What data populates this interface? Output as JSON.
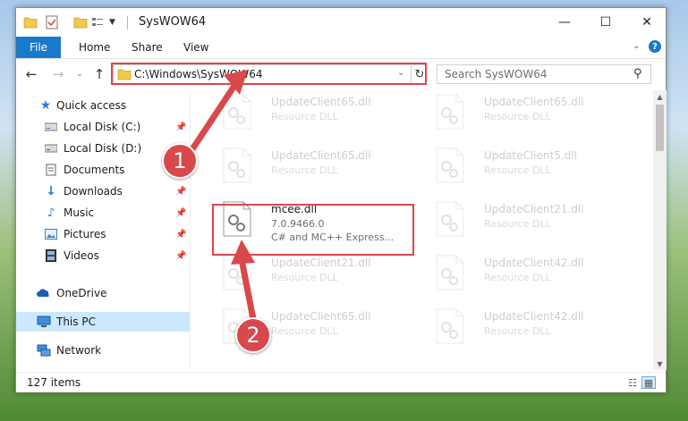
{
  "window": {
    "title": "SysWOW64",
    "controls": {
      "minimize": "—",
      "maximize": "☐",
      "close": "✕"
    }
  },
  "ribbon": {
    "tabs": [
      "File",
      "Home",
      "Share",
      "View"
    ],
    "help": "?"
  },
  "address_bar": {
    "path": "C:\\Windows\\SysWOW64",
    "refresh_icon": "↻"
  },
  "search": {
    "placeholder": "Search SysWOW64"
  },
  "sidebar": {
    "items": [
      {
        "label": "Quick access",
        "icon": "star-icon",
        "pinned": false
      },
      {
        "label": "Local Disk (C:)",
        "icon": "drive-icon",
        "pinned": true
      },
      {
        "label": "Local Disk (D:)",
        "icon": "drive-icon",
        "pinned": false
      },
      {
        "label": "Documents",
        "icon": "documents-icon",
        "pinned": true
      },
      {
        "label": "Downloads",
        "icon": "download-icon",
        "pinned": true
      },
      {
        "label": "Music",
        "icon": "music-icon",
        "pinned": true
      },
      {
        "label": "Pictures",
        "icon": "pictures-icon",
        "pinned": true
      },
      {
        "label": "Videos",
        "icon": "videos-icon",
        "pinned": true
      },
      {
        "label": "OneDrive",
        "icon": "cloud-icon",
        "pinned": false
      },
      {
        "label": "This PC",
        "icon": "computer-icon",
        "pinned": false,
        "selected": true
      },
      {
        "label": "Network",
        "icon": "network-icon",
        "pinned": false
      }
    ]
  },
  "files": {
    "left": [
      {
        "name": "UpdateClient65.dll",
        "desc": "Resource DLL"
      },
      {
        "name": "UpdateClient65.dll",
        "desc": "Resource DLL"
      },
      {
        "name": "mcee.dll",
        "desc": "7.0.9466.0",
        "desc2": "C# and MC++ Express...",
        "focus": true
      },
      {
        "name": "UpdateClient21.dll",
        "desc": "Resource DLL"
      },
      {
        "name": "UpdateClient65.dll",
        "desc": "Resource DLL"
      }
    ],
    "right": [
      {
        "name": "UpdateClient65.dll",
        "desc": "Resource DLL"
      },
      {
        "name": "UpdateClient5.dll",
        "desc": "Resource DLL"
      },
      {
        "name": "UpdateClient21.dll",
        "desc": "Resource DLL"
      },
      {
        "name": "UpdateClient42.dll",
        "desc": "Resource DLL"
      },
      {
        "name": "UpdateClient42.dll",
        "desc": "Resource DLL"
      }
    ]
  },
  "status": {
    "item_count": "127 items"
  },
  "annotations": {
    "step1": "1",
    "step2": "2",
    "color": "#d9484b"
  }
}
